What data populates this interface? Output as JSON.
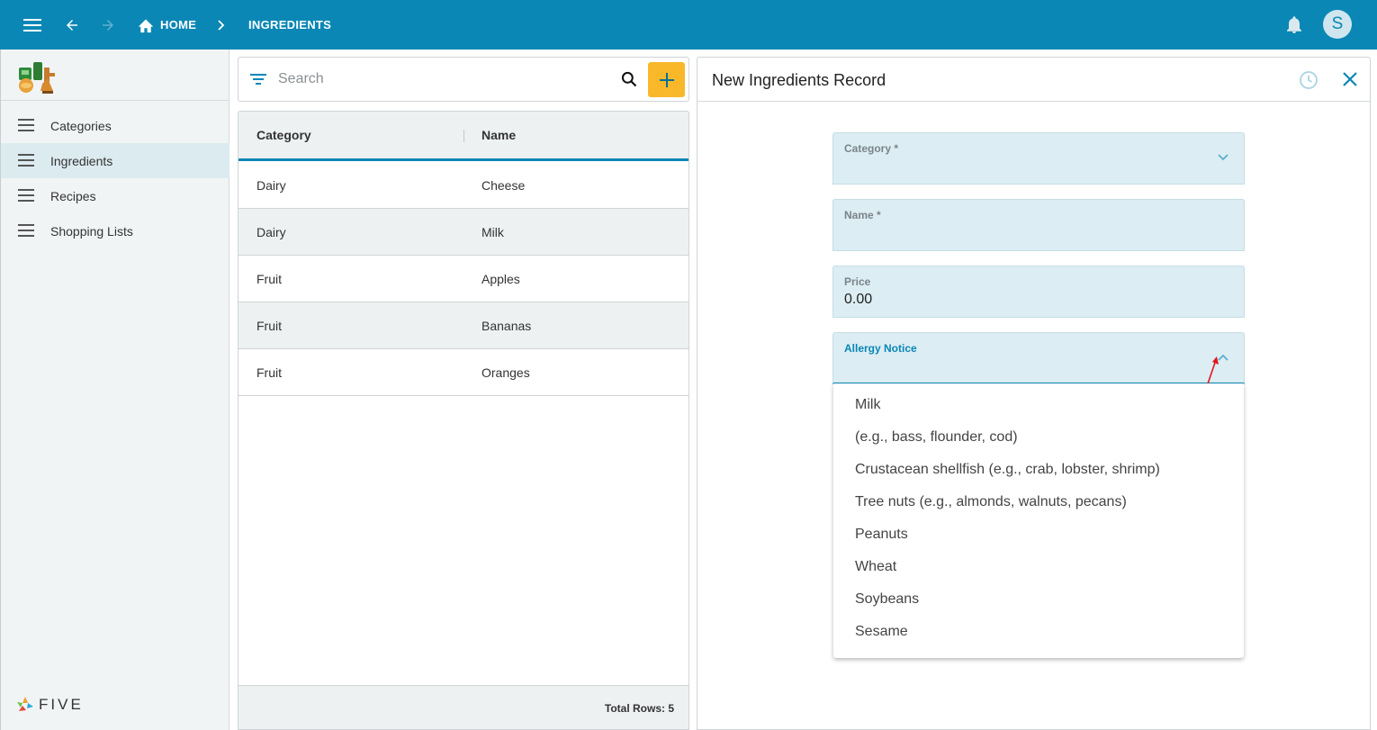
{
  "topbar": {
    "home_label": "HOME",
    "current_label": "INGREDIENTS",
    "user_initial": "S",
    "color": "#0a87b5"
  },
  "sidebar": {
    "items": [
      {
        "label": "Categories",
        "active": false
      },
      {
        "label": "Ingredients",
        "active": true
      },
      {
        "label": "Recipes",
        "active": false
      },
      {
        "label": "Shopping Lists",
        "active": false
      }
    ],
    "footer_logo_text": "FIVE"
  },
  "search": {
    "placeholder": "Search",
    "value": ""
  },
  "grid": {
    "columns": [
      "Category",
      "Name"
    ],
    "rows": [
      {
        "category": "Dairy",
        "name": "Cheese"
      },
      {
        "category": "Dairy",
        "name": "Milk"
      },
      {
        "category": "Fruit",
        "name": "Apples"
      },
      {
        "category": "Fruit",
        "name": "Bananas"
      },
      {
        "category": "Fruit",
        "name": "Oranges"
      }
    ],
    "total_rows_label": "Total Rows: 5"
  },
  "form": {
    "title": "New Ingredients Record",
    "fields": {
      "category": {
        "label": "Category *",
        "value": ""
      },
      "name": {
        "label": "Name *",
        "value": ""
      },
      "price": {
        "label": "Price",
        "value": "0.00"
      },
      "allergy": {
        "label": "Allergy Notice",
        "value": ""
      }
    },
    "allergy_options": [
      "Milk",
      "(e.g., bass, flounder, cod)",
      "Crustacean shellfish (e.g., crab, lobster, shrimp)",
      "Tree nuts (e.g., almonds, walnuts, pecans)",
      "Peanuts",
      "Wheat",
      "Soybeans",
      "Sesame"
    ]
  },
  "colors": {
    "accent": "#0a87b5",
    "add_button": "#f8b82a",
    "field_bg": "#dcedf3",
    "annotation_arrow": "#e0191b"
  },
  "icons": [
    "menu-icon",
    "back-arrow-icon",
    "forward-arrow-icon",
    "home-icon",
    "chevron-right-icon",
    "bell-icon",
    "hamburger-icon",
    "filter-icon",
    "search-icon",
    "plus-icon",
    "history-icon",
    "close-icon",
    "chevron-down-icon",
    "chevron-up-icon"
  ]
}
